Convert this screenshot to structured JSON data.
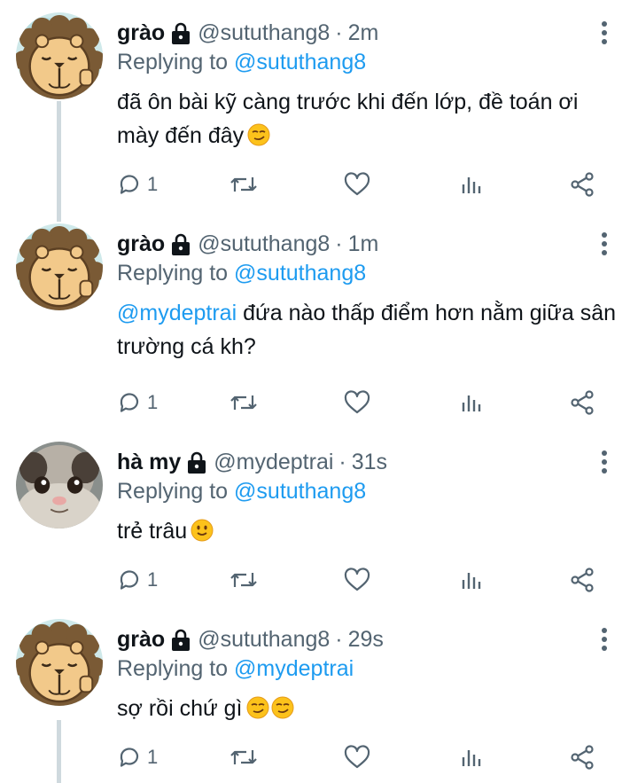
{
  "colors": {
    "accent": "#1d9bf0",
    "muted": "#536471",
    "text": "#0f1419",
    "thread_line": "#cfd9de"
  },
  "replying_prefix": "Replying to",
  "tweets": [
    {
      "name": "grào",
      "handle": "@sututhang8",
      "dot": "·",
      "time": "2m",
      "reply_to": "@sututhang8",
      "mention": "",
      "text": "đã ôn bài kỹ càng trước khi đến lớp, đề toán ơi mày đến đây",
      "emojis": [
        "smirk-emoji"
      ],
      "reply_count": "1",
      "avatar": "lion-avatar"
    },
    {
      "name": "grào",
      "handle": "@sututhang8",
      "dot": "·",
      "time": "1m",
      "reply_to": "@sututhang8",
      "mention": "@mydeptrai",
      "text": " đứa nào thấp điểm hơn nằm giữa sân trường cá kh?",
      "emojis": [],
      "reply_count": "1",
      "avatar": "lion-avatar"
    },
    {
      "name": "hà my",
      "handle": "@mydeptrai",
      "dot": "·",
      "time": "31s",
      "reply_to": "@sututhang8",
      "mention": "",
      "text": "trẻ trâu",
      "emojis": [
        "slight-smile-emoji"
      ],
      "reply_count": "1",
      "avatar": "cat-avatar"
    },
    {
      "name": "grào",
      "handle": "@sututhang8",
      "dot": "·",
      "time": "29s",
      "reply_to": "@mydeptrai",
      "mention": "",
      "text": "sợ rồi chứ gì",
      "emojis": [
        "smirk-emoji",
        "smirk-emoji"
      ],
      "reply_count": "1",
      "avatar": "lion-avatar"
    }
  ],
  "icons": [
    "lock-icon",
    "more-icon",
    "reply-icon",
    "retweet-icon",
    "like-icon",
    "analytics-icon",
    "share-icon"
  ]
}
